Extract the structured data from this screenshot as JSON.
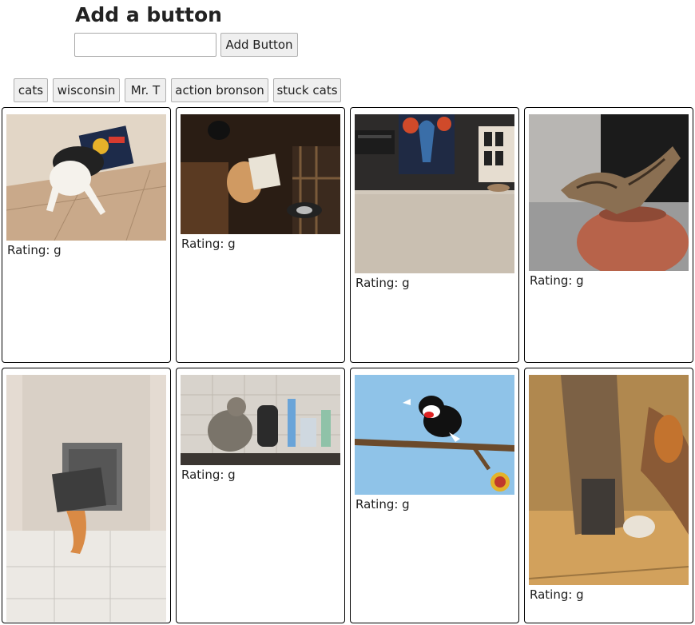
{
  "form": {
    "heading": "Add a button",
    "input_value": "",
    "input_placeholder": "",
    "add_button_label": "Add Button"
  },
  "topic_buttons": [
    {
      "label": "cats"
    },
    {
      "label": "wisconsin"
    },
    {
      "label": "Mr. T"
    },
    {
      "label": "action bronson"
    },
    {
      "label": "stuck cats"
    }
  ],
  "gifs": [
    {
      "rating_text": "Rating: g",
      "subject": "cat with head stuck in cereal box"
    },
    {
      "rating_text": "Rating: g",
      "subject": "cat with head stuck in tissue box"
    },
    {
      "rating_text": "Rating: g",
      "subject": "living room carpet with vase painting"
    },
    {
      "rating_text": "Rating: g",
      "subject": "cat stuck in clay vase"
    },
    {
      "rating_text": "Rating: g",
      "subject": "orange cat stuck in cat flap"
    },
    {
      "rating_text": "Rating: g",
      "subject": "tabby cat on kitchen counter"
    },
    {
      "rating_text": "Rating: g",
      "subject": "Sylvester cartoon on tree branch"
    },
    {
      "rating_text": "Rating: g",
      "subject": "cat stuck in box under table"
    }
  ]
}
